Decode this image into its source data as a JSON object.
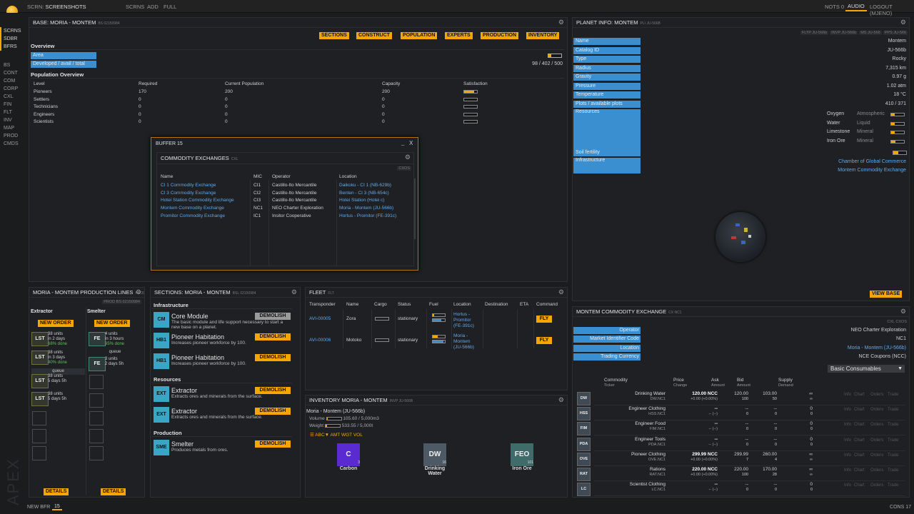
{
  "topbar": {
    "screen_label": "SCRN:",
    "screen_name": "SCREENSHOTS",
    "tabs": [
      "SCRNS",
      "ADD",
      "FULL"
    ],
    "right": [
      "NOTS 0",
      "AUDIO",
      "LOGOUT (MJENO)"
    ]
  },
  "leftnav": {
    "top": [
      "SCRNS",
      "SDBR",
      "BFRS"
    ],
    "bottom": [
      "BS",
      "CONT",
      "COM",
      "CORP",
      "CXL",
      "FIN",
      "FLT",
      "INV",
      "MAP",
      "PROD",
      "CMDS"
    ]
  },
  "bottombar": {
    "new_bfr": "NEW BFR",
    "count": "15",
    "cons": "CONS 17"
  },
  "watermark": "APEX",
  "base": {
    "title": "BASE: MORIA - MONTEM",
    "code": "BS 02150984",
    "buttons": [
      "SECTIONS",
      "CONSTRUCT",
      "POPULATION",
      "EXPERTS",
      "PRODUCTION",
      "INVENTORY"
    ],
    "overview": "Overview",
    "area": "Area",
    "developed": "Developed / avail / total",
    "developed_val": "98 / 402 / 500",
    "area_fill": 0.2,
    "pop_title": "Population Overview",
    "headers": [
      "Level",
      "Required",
      "Current Population",
      "Capacity",
      "Satisfaction"
    ],
    "rows": [
      {
        "level": "Pioneers",
        "required": "170",
        "current": "200",
        "capacity": "200",
        "sat": 0.8
      },
      {
        "level": "Settlers",
        "required": "0",
        "current": "0",
        "capacity": "0",
        "sat": 0
      },
      {
        "level": "Technicians",
        "required": "0",
        "current": "0",
        "capacity": "0",
        "sat": 0
      },
      {
        "level": "Engineers",
        "required": "0",
        "current": "0",
        "capacity": "0",
        "sat": 0
      },
      {
        "level": "Scientists",
        "required": "0",
        "current": "0",
        "capacity": "0",
        "sat": 0
      }
    ]
  },
  "buffer": {
    "title": "BUFFER 15",
    "close": "X",
    "min": "_",
    "cx_title": "COMMODITY EXCHANGES",
    "cx_code": "CXL",
    "cxos": "CXOS",
    "headers": [
      "Name",
      "MIC",
      "Operator",
      "Location"
    ],
    "rows": [
      {
        "name": "CI 1 Commodity Exchange",
        "mic": "CI1",
        "op": "Castillo-Ito Mercantile",
        "loc": "Daikoku - CI 1 (NB-629b)"
      },
      {
        "name": "CI 3 Commodity Exchange",
        "mic": "CI2",
        "op": "Castillo-Ito Mercantile",
        "loc": "Benten - CI 3 (NB-654c)"
      },
      {
        "name": "Hotei Station Commodity Exchange",
        "mic": "CI3",
        "op": "Castillo-Ito Mercantile",
        "loc": "Hotei Station (Hotei c)"
      },
      {
        "name": "Montem Commodity Exchange",
        "mic": "NC1",
        "op": "NEO Charter Exploration",
        "loc": "Moria - Montem (JU-566b)"
      },
      {
        "name": "Promitor Commodity Exchange",
        "mic": "IC1",
        "op": "Insitor Cooperative",
        "loc": "Hortus - Promitor (FE-391c)"
      }
    ]
  },
  "planet": {
    "title": "PLANET INFO: MONTEM",
    "code": "PLI JU-566B",
    "shortcuts": [
      "FLTP JU-566b",
      "INVP JU-566b",
      "MS JU-566",
      "PPS JU-566"
    ],
    "rows": [
      {
        "label": "Name",
        "value": "Montem"
      },
      {
        "label": "Catalog ID",
        "value": "JU-566b"
      },
      {
        "label": "Type",
        "value": "Rocky"
      },
      {
        "label": "Radius",
        "value": "7,315 km"
      },
      {
        "label": "Gravity",
        "value": "0.97 g"
      },
      {
        "label": "Pressure",
        "value": "1.02 atm"
      },
      {
        "label": "Temperature",
        "value": "18 °C"
      },
      {
        "label": "Plots / available plots",
        "value": "410 / 371"
      }
    ],
    "resources_label": "Resources",
    "resources": [
      {
        "name": "Oxygen",
        "type": "Atmospheric",
        "level": 0.3
      },
      {
        "name": "Water",
        "type": "Liquid",
        "level": 0.25
      },
      {
        "name": "Limestone",
        "type": "Mineral",
        "level": 0.3
      },
      {
        "name": "Iron Ore",
        "type": "Mineral",
        "level": 0.35
      }
    ],
    "soil": "Soil fertility",
    "infra": "Infrastructure",
    "infra_items": [
      "Chamber of Global Commerce",
      "Montem Commodity Exchange"
    ],
    "view_base": "VIEW BASE"
  },
  "prodlines": {
    "title": "MORIA - MONTEM PRODUCTION LINES",
    "code": "PROD",
    "bs": "BS 02150984",
    "cols": [
      {
        "name": "Extractor",
        "order": "NEW ORDER",
        "details": "DETAILS"
      },
      {
        "name": "Smelter",
        "order": "NEW ORDER",
        "details": "DETAILS"
      }
    ],
    "ext_items": [
      {
        "tkr": "LST",
        "a": "38 units",
        "b": "in 2 days",
        "c": "68% done"
      },
      {
        "tkr": "LST",
        "a": "38 units",
        "b": "in 3 days",
        "c": "40% done"
      },
      {
        "tkr": "LST",
        "a": "38 units",
        "b": "5 days 5h",
        "c": ""
      },
      {
        "tkr": "LST",
        "a": "38 units",
        "b": "5 days 5h",
        "c": ""
      }
    ],
    "sm_items": [
      {
        "tkr": "FE",
        "a": "4 units",
        "b": "in 3 hours",
        "c": "95% done"
      },
      {
        "tkr": "FE",
        "a": "3 units",
        "b": "2 days 5h",
        "c": ""
      }
    ],
    "queue": "queue"
  },
  "sections": {
    "title": "SECTIONS: MORIA - MONTEM",
    "code": "BSL 02150984",
    "demolish": "DEMOLISH",
    "groups": [
      {
        "name": "Infrastructure",
        "items": [
          {
            "tkr": "CM",
            "name": "Core Module",
            "desc": "The basic module and life support necessary to start a new base on a planet."
          },
          {
            "tkr": "HB1",
            "name": "Pioneer Habitation",
            "desc": "Increases pioneer workforce by 100."
          },
          {
            "tkr": "HB1",
            "name": "Pioneer Habitation",
            "desc": "Increases pioneer workforce by 100."
          }
        ]
      },
      {
        "name": "Resources",
        "items": [
          {
            "tkr": "EXT",
            "name": "Extractor",
            "desc": "Extracts ores and minerals from the surface."
          },
          {
            "tkr": "EXT",
            "name": "Extractor",
            "desc": "Extracts ores and minerals from the surface."
          }
        ]
      },
      {
        "name": "Production",
        "items": [
          {
            "tkr": "SME",
            "name": "Smelter",
            "desc": "Produces metals from ores."
          }
        ]
      }
    ]
  },
  "fleet": {
    "title": "FLEET",
    "code": "FLT",
    "headers": [
      "Transponder",
      "Name",
      "Cargo",
      "Status",
      "Fuel",
      "Location",
      "Destination",
      "ETA",
      "Command"
    ],
    "rows": [
      {
        "tr": "AVI-00005",
        "name": "Zora",
        "status": "stationary",
        "loc": [
          "Hortus -",
          "Promitor",
          "(FE-391c)"
        ],
        "cmd": "FLY",
        "fuel_a": 0.1,
        "fuel_b": 0.7
      },
      {
        "tr": "AVI-00006",
        "name": "Motoko",
        "status": "stationary",
        "loc": [
          "Moria -",
          "Montem",
          "(JU-566b)"
        ],
        "cmd": "FLY",
        "fuel_a": 0.4,
        "fuel_b": 0.9
      }
    ]
  },
  "inventory": {
    "title": "INVENTORY MORIA - MONTEM",
    "code": "INVP JU-566B",
    "loc": "Moria - Montem (JU-566b)",
    "volume_label": "Volume",
    "volume": "105.60 / 5,000m3",
    "weight_label": "Weight",
    "weight": "533.55 / 5,000t",
    "sort": [
      "ABC",
      "AMT",
      "WGT",
      "VOL"
    ],
    "items": [
      {
        "tkr": "C",
        "name": "Carbon",
        "qty": "3",
        "color": "#5a2bd1"
      },
      {
        "tkr": "DW",
        "name": "Drinking Water",
        "qty": "16",
        "color": "#4d5a66"
      },
      {
        "tkr": "FEO",
        "name": "Iron Ore",
        "qty": "101",
        "color": "#3f6b6b"
      }
    ]
  },
  "cx": {
    "title": "MONTEM COMMODITY EXCHANGE",
    "code": "CX NC1",
    "shortcuts": [
      "CXL",
      "CXOS"
    ],
    "rows": [
      {
        "label": "Operator",
        "value": "NEO Charter Exploration"
      },
      {
        "label": "Market Identifier Code",
        "value": "NC1"
      },
      {
        "label": "Location",
        "value": "Moria - Montem (JU-566b)"
      },
      {
        "label": "Trading Currency",
        "value": "NCE Coupons (NCC)"
      }
    ],
    "category": "Basic Consumables",
    "headers": [
      [
        "Commodity",
        "Ticker"
      ],
      [
        "Price",
        "Change"
      ],
      [
        "Ask",
        "Amount"
      ],
      [
        "Bid",
        "Amount"
      ],
      [
        "Supply",
        "Demand"
      ]
    ],
    "actions": [
      "Info",
      "Chart",
      "Orders",
      "Trade"
    ],
    "rows2": [
      {
        "icon": "DW",
        "name": "Drinking Water",
        "tk": "DW.NC1",
        "price": "120.00 NCC",
        "chg": "+0.00 (+0.00%)",
        "ask": "120.00",
        "askq": "100",
        "bid": "103.00",
        "bidq": "50",
        "s": "∞",
        "d": "∞"
      },
      {
        "icon": "HSS",
        "name": "Engineer Clothing",
        "tk": "HSS.NC1",
        "price": "--",
        "chg": "-- (--)",
        "ask": "--",
        "askq": "0",
        "bid": "--",
        "bidq": "0",
        "s": "0",
        "d": "0"
      },
      {
        "icon": "FIM",
        "name": "Engineer Food",
        "tk": "FIM.NC1",
        "price": "--",
        "chg": "-- (--)",
        "ask": "--",
        "askq": "0",
        "bid": "--",
        "bidq": "0",
        "s": "0",
        "d": "0"
      },
      {
        "icon": "PDA",
        "name": "Engineer Tools",
        "tk": "PDA.NC1",
        "price": "--",
        "chg": "-- (--)",
        "ask": "--",
        "askq": "0",
        "bid": "--",
        "bidq": "0",
        "s": "0",
        "d": "0"
      },
      {
        "icon": "OVE",
        "name": "Pioneer Clothing",
        "tk": "OVE.NC1",
        "price": "299.99 NCC",
        "chg": "+0.00 (+0.00%)",
        "ask": "299.99",
        "askq": "7",
        "bid": "260.00",
        "bidq": "4",
        "s": "∞",
        "d": "∞"
      },
      {
        "icon": "RAT",
        "name": "Rations",
        "tk": "RAT.NC1",
        "price": "220.00 NCC",
        "chg": "+0.00 (+0.00%)",
        "ask": "220.00",
        "askq": "100",
        "bid": "170.00",
        "bidq": "28",
        "s": "∞",
        "d": "∞"
      },
      {
        "icon": "LC",
        "name": "Scientist Clothing",
        "tk": "LC.NC1",
        "price": "--",
        "chg": "-- (--)",
        "ask": "--",
        "askq": "0",
        "bid": "--",
        "bidq": "0",
        "s": "0",
        "d": "0"
      }
    ]
  }
}
